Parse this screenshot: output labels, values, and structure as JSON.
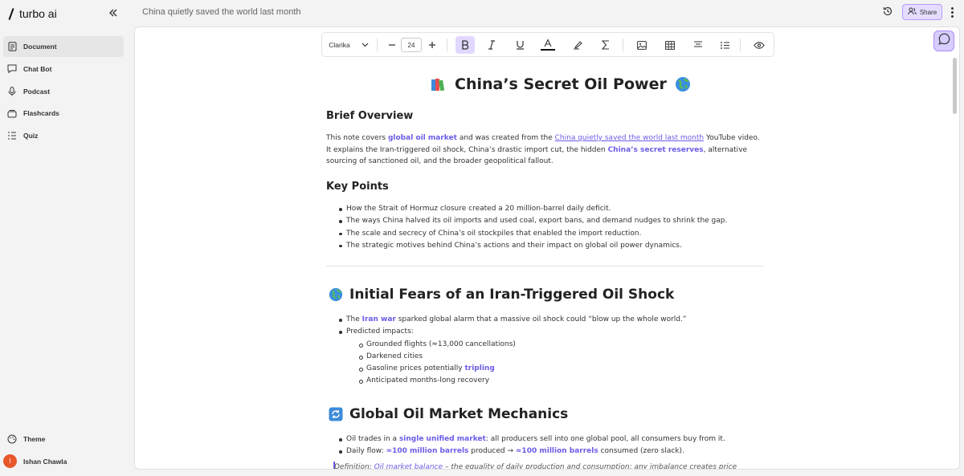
{
  "brand": {
    "name": "turbo ai"
  },
  "sidebar": {
    "items": [
      {
        "label": "Document",
        "icon": "document-icon",
        "active": true
      },
      {
        "label": "Chat Bot",
        "icon": "chat-icon"
      },
      {
        "label": "Podcast",
        "icon": "microphone-icon"
      },
      {
        "label": "Flashcards",
        "icon": "cards-icon"
      },
      {
        "label": "Quiz",
        "icon": "list-icon"
      }
    ],
    "theme_label": "Theme",
    "user": {
      "initial": "I",
      "name": "Ishan Chawla"
    }
  },
  "topbar": {
    "doc_title": "China quietly saved the world last month",
    "share_label": "Share"
  },
  "toolbar": {
    "font": "Clarika",
    "font_size": "24"
  },
  "doc": {
    "title": "China’s Secret Oil Power",
    "overview_heading": "Brief Overview",
    "overview": {
      "t1": "This note covers ",
      "k1": "global oil market",
      "t2": " and was created from the ",
      "link": "China quietly saved the world last month",
      "t3": " YouTube video. It explains the Iran-triggered oil shock, China’s drastic import cut, the hidden ",
      "k2": "China’s secret reserves",
      "t4": ", alternative sourcing of sanctioned oil, and the broader geopolitical fallout."
    },
    "keypoints_heading": "Key Points",
    "keypoints": [
      "How the Strait of Hormuz closure created a 20 million-barrel daily deficit.",
      "The ways China halved its oil imports and used coal, export bans, and demand nudges to shrink the gap.",
      "The scale and secrecy of China’s oil stockpiles that enabled the import reduction.",
      "The strategic motives behind China’s actions and their impact on global oil power dynamics."
    ],
    "section1_heading": "Initial Fears of an Iran-Triggered Oil Shock",
    "section1": {
      "b1_t1": "The ",
      "b1_k": "Iran war",
      "b1_t2": " sparked global alarm that a massive oil shock could “blow up the whole world.”",
      "b2": "Predicted impacts:",
      "sub1": "Grounded flights (≈13,000 cancellations)",
      "sub2": "Darkened cities",
      "sub3_t": "Gasoline prices potentially ",
      "sub3_k": "tripling",
      "sub4": "Anticipated months-long recovery"
    },
    "section2_heading": "Global Oil Market Mechanics",
    "section2": {
      "b1_t1": "Oil trades in a ",
      "b1_k": "single unified market",
      "b1_t2": ": all producers sell into one global pool, all consumers buy from it.",
      "b2_t1": "Daily flow: ",
      "b2_k1": "≈100 million barrels",
      "b2_t2": " produced → ",
      "b2_k2": "≈100 million barrels",
      "b2_t3": " consumed (zero slack).",
      "def_t1": "Definition: ",
      "def_link": "Oil market balance",
      "def_t2": " – the equality of daily production and consumption; any imbalance creates price"
    }
  },
  "colors": {
    "accent": "#6b5ce7",
    "accent_bg": "#e2d8ff",
    "avatar": "#e8572a"
  }
}
